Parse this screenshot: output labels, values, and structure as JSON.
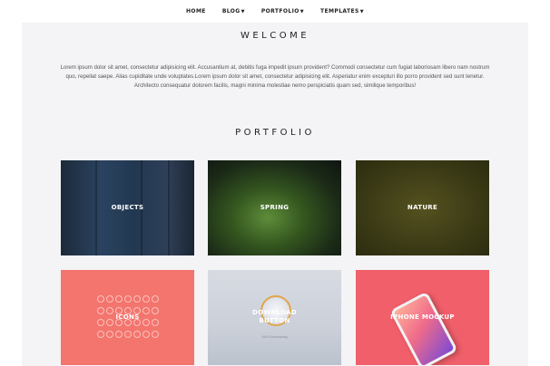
{
  "nav": {
    "items": [
      {
        "label": "HOME",
        "has_dropdown": false
      },
      {
        "label": "BLOG",
        "has_dropdown": true
      },
      {
        "label": "PORTFOLIO",
        "has_dropdown": true
      },
      {
        "label": "TEMPLATES",
        "has_dropdown": true
      }
    ]
  },
  "welcome": {
    "title": "WELCOME",
    "text": "Lorem ipsum dolor sit amet, consectetur adipisicing elit. Accusantium at, debitis fuga impedit ipsum provident? Commodi consectetur cum fugiat laboriosam libero nam nostrum quo, repellat saepe. Alias cupiditate unde voluptates.Lorem ipsum dolor sit amet, consectetur adipisicing elit. Asperiatur enim excepturi illo porro provident sed sunt tenetur. Architecto consequatur dolorem facilis, magni minima molestiae nemo perspiciatis quam sed, similique temporibus!"
  },
  "portfolio": {
    "title": "PORTFOLIO",
    "tiles": [
      {
        "label": "OBJECTS"
      },
      {
        "label": "SPRING"
      },
      {
        "label": "NATURE"
      },
      {
        "label": "ICONS"
      },
      {
        "label": "DOWNLOAD BUTTON",
        "line1": "DOWNLOAD",
        "line2": "BUTTON",
        "caption": "48% Downloading"
      },
      {
        "label": "IPHONE MOCKUP"
      }
    ]
  },
  "icons": {
    "caret": "chevron-down-icon"
  }
}
